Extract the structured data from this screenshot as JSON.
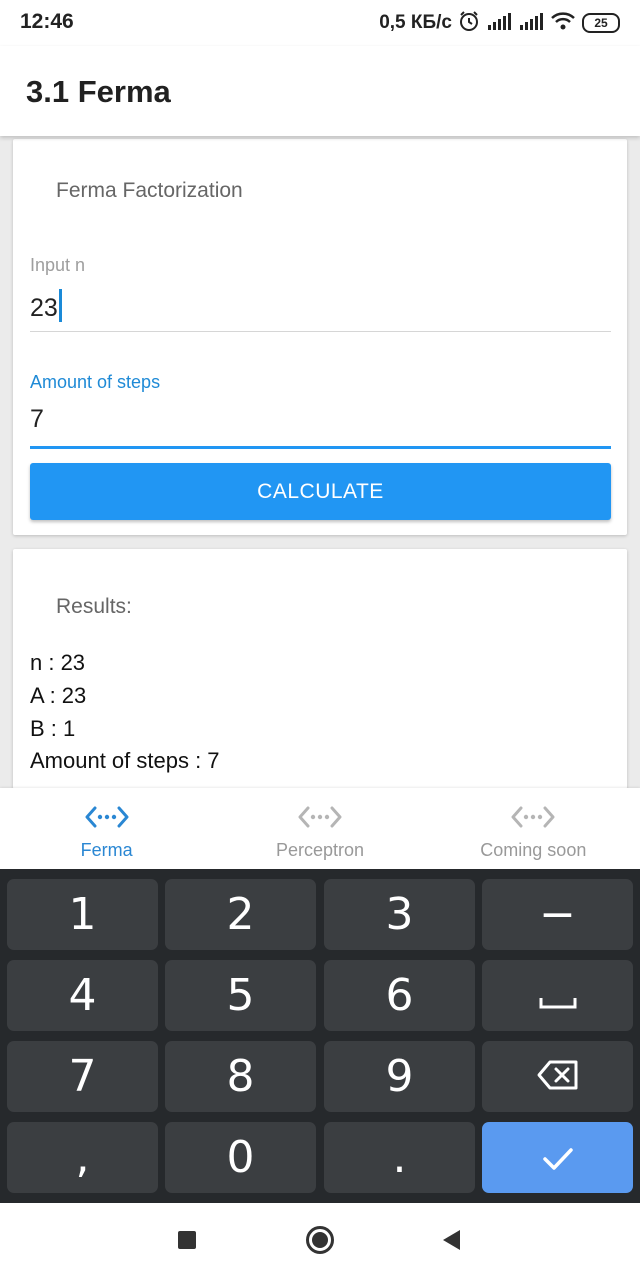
{
  "status_bar": {
    "time": "12:46",
    "net_speed": "0,5 КБ/с",
    "battery": "25",
    "icons": [
      "alarm-icon",
      "signal-icon",
      "signal-icon",
      "wifi-icon",
      "battery-icon"
    ]
  },
  "app_bar": {
    "title": "3.1 Ferma"
  },
  "form_card": {
    "title": "Ferma Factorization",
    "input_n": {
      "label": "Input n",
      "value": "23"
    },
    "steps": {
      "label": "Amount of steps",
      "value": "7"
    },
    "calculate_label": "CALCULATE"
  },
  "results_card": {
    "title": "Results:",
    "lines": [
      "n : 23",
      "A : 23",
      "B : 1",
      "Amount of steps : 7"
    ]
  },
  "bottom_nav": {
    "items": [
      {
        "label": "Ferma",
        "icon": "code-arrows-icon",
        "active": true
      },
      {
        "label": "Perceptron",
        "icon": "code-arrows-icon",
        "active": false
      },
      {
        "label": "Coming soon",
        "icon": "code-arrows-icon",
        "active": false
      }
    ]
  },
  "keyboard": {
    "keys": [
      "1",
      "2",
      "3",
      "−",
      "4",
      "5",
      "6",
      "space",
      "7",
      "8",
      "9",
      "backspace",
      ",",
      "0",
      ".",
      "done"
    ]
  },
  "colors": {
    "accent": "#2196f3",
    "active_tab": "#2a87d3",
    "keyboard_bg": "#26292c",
    "key_bg": "#3b3e41",
    "enter_key": "#5a9af0"
  }
}
